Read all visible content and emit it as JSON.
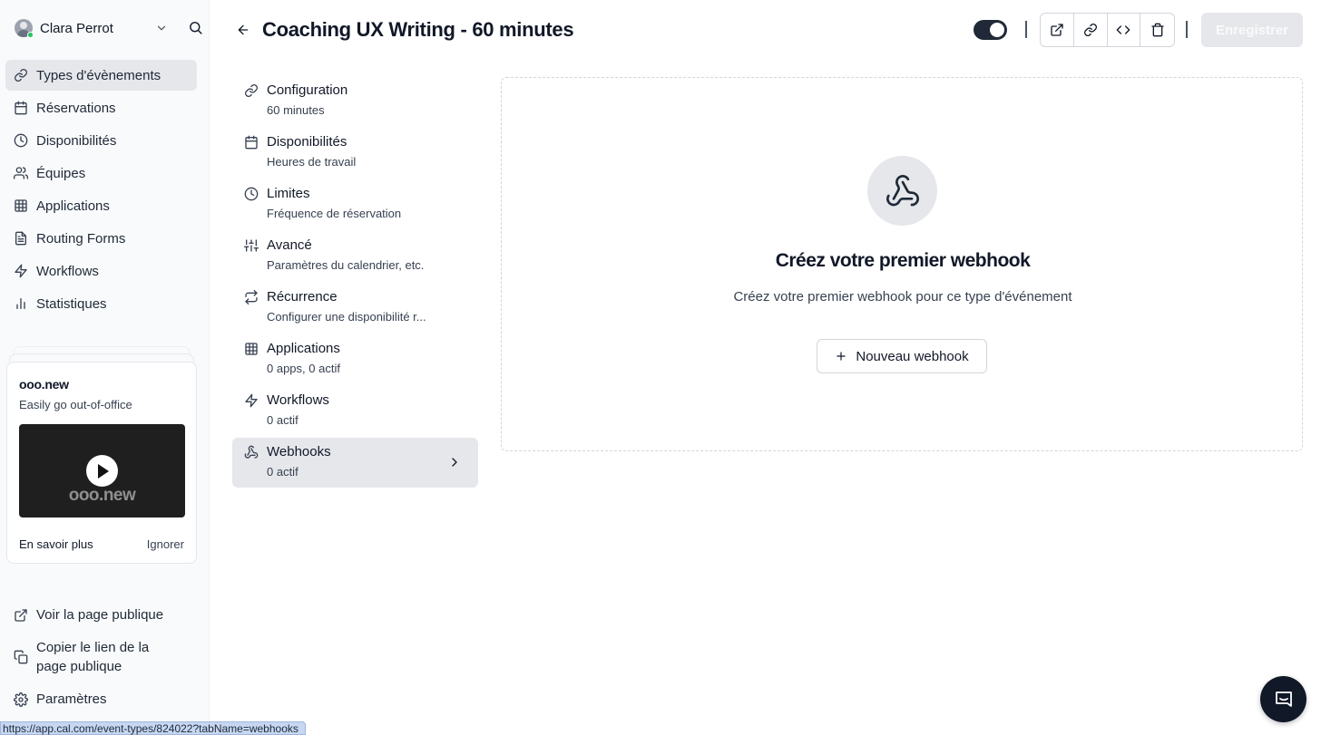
{
  "user": {
    "name": "Clara Perrot"
  },
  "sidebar": {
    "items": [
      {
        "label": "Types d'évènements",
        "icon": "link-icon",
        "active": true
      },
      {
        "label": "Réservations",
        "icon": "calendar-icon"
      },
      {
        "label": "Disponibilités",
        "icon": "clock-icon"
      },
      {
        "label": "Équipes",
        "icon": "users-icon"
      },
      {
        "label": "Applications",
        "icon": "grid-icon"
      },
      {
        "label": "Routing Forms",
        "icon": "file-text-icon"
      },
      {
        "label": "Workflows",
        "icon": "zap-icon"
      },
      {
        "label": "Statistiques",
        "icon": "bar-chart-icon"
      }
    ],
    "promo": {
      "title": "ooo.new",
      "subtitle": "Easily go out-of-office",
      "video_brand": "ooo.new",
      "learn_more": "En savoir plus",
      "dismiss": "Ignorer"
    },
    "bottom": [
      {
        "label": "Voir la page publique",
        "icon": "external-link-icon"
      },
      {
        "label": "Copier le lien de la page publique",
        "icon": "copy-icon"
      },
      {
        "label": "Paramètres",
        "icon": "settings-icon"
      }
    ]
  },
  "status_url": "https://app.cal.com/event-types/824022?tabName=webhooks",
  "header": {
    "title": "Coaching UX Writing - 60 minutes",
    "toggle_on": true,
    "save_label": "Enregistrer"
  },
  "subnav": {
    "items": [
      {
        "label": "Configuration",
        "desc": "60 minutes",
        "icon": "link-icon"
      },
      {
        "label": "Disponibilités",
        "desc": "Heures de travail",
        "icon": "calendar-icon"
      },
      {
        "label": "Limites",
        "desc": "Fréquence de réservation",
        "icon": "clock-icon"
      },
      {
        "label": "Avancé",
        "desc": "Paramètres du calendrier, etc.",
        "icon": "sliders-icon"
      },
      {
        "label": "Récurrence",
        "desc": "Configurer une disponibilité r...",
        "icon": "repeat-icon"
      },
      {
        "label": "Applications",
        "desc": "0 apps, 0 actif",
        "icon": "grid-icon"
      },
      {
        "label": "Workflows",
        "desc": "0 actif",
        "icon": "zap-icon"
      },
      {
        "label": "Webhooks",
        "desc": "0 actif",
        "icon": "webhook-icon",
        "active": true
      }
    ]
  },
  "empty": {
    "title": "Créez votre premier webhook",
    "description": "Créez votre premier webhook pour ce type d'événement",
    "button": "Nouveau webhook"
  }
}
